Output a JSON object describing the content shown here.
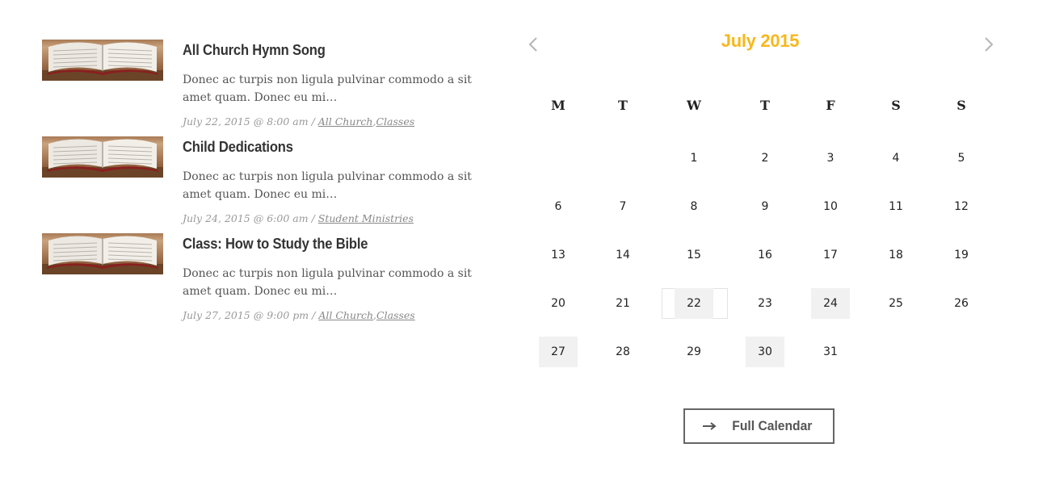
{
  "events": [
    {
      "title": "All Church Hymn Song",
      "excerpt": "Donec ac turpis non ligula pulvinar commodo a sit amet quam. Donec eu mi…",
      "datetime": "July 22, 2015 @ 8:00 am",
      "separator": "/",
      "categories": [
        "All Church",
        "Classes"
      ]
    },
    {
      "title": "Child Dedications",
      "excerpt": "Donec ac turpis non ligula pulvinar commodo a sit amet quam. Donec eu mi…",
      "datetime": "July 24, 2015 @ 6:00 am",
      "separator": "/",
      "categories": [
        "Student Ministries"
      ]
    },
    {
      "title": "Class: How to Study the Bible",
      "excerpt": "Donec ac turpis non ligula pulvinar commodo a sit amet quam. Donec eu mi…",
      "datetime": "July 27, 2015 @ 9:00 pm",
      "separator": "/",
      "categories": [
        "All Church",
        "Classes"
      ]
    }
  ],
  "calendar": {
    "title": "July 2015",
    "prev_icon": "chevron-left-icon",
    "next_icon": "chevron-right-icon",
    "weekdays": [
      "M",
      "T",
      "W",
      "T",
      "F",
      "S",
      "S"
    ],
    "weeks": [
      [
        "",
        "",
        "1",
        "2",
        "3",
        "4",
        "5"
      ],
      [
        "6",
        "7",
        "8",
        "9",
        "10",
        "11",
        "12"
      ],
      [
        "13",
        "14",
        "15",
        "16",
        "17",
        "18",
        "19"
      ],
      [
        "20",
        "21",
        "22",
        "23",
        "24",
        "25",
        "26"
      ],
      [
        "27",
        "28",
        "29",
        "30",
        "31",
        "",
        ""
      ]
    ],
    "event_days": [
      "22",
      "24",
      "27",
      "30"
    ],
    "today": "22",
    "full_calendar_label": "Full Calendar",
    "full_calendar_icon": "arrow-right-icon"
  },
  "colors": {
    "accent": "#f7b81c",
    "event_day_bg": "#f1f1f1"
  }
}
